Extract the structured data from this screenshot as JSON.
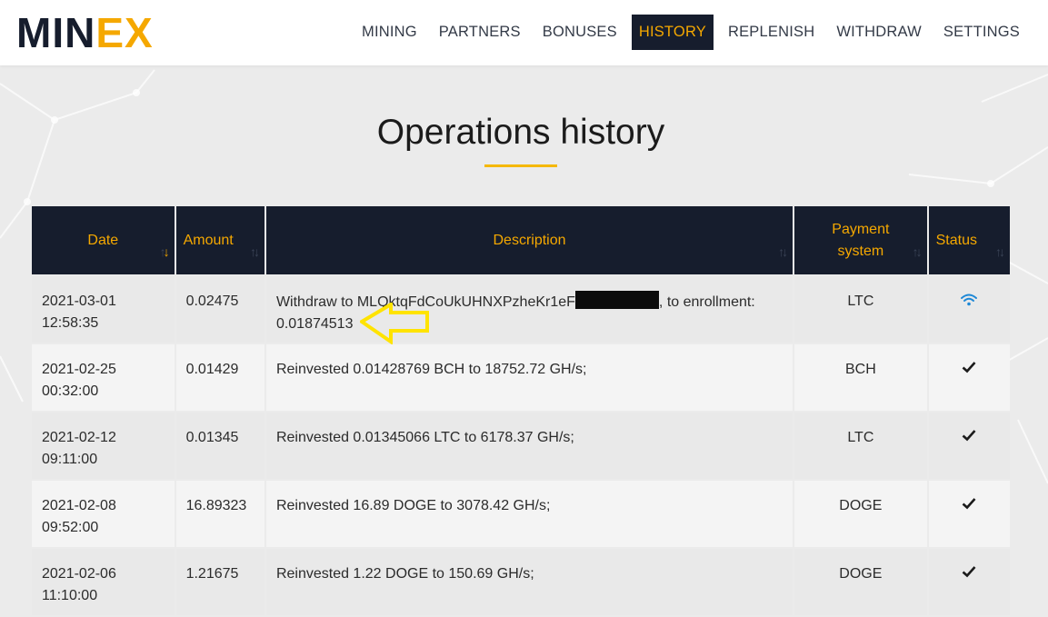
{
  "header": {
    "logo_prefix": "MIN",
    "logo_x": "EX",
    "nav": [
      {
        "label": "MINING",
        "active": false
      },
      {
        "label": "PARTNERS",
        "active": false
      },
      {
        "label": "BONUSES",
        "active": false
      },
      {
        "label": "HISTORY",
        "active": true
      },
      {
        "label": "REPLENISH",
        "active": false
      },
      {
        "label": "WITHDRAW",
        "active": false
      },
      {
        "label": "SETTINGS",
        "active": false
      }
    ]
  },
  "page": {
    "title": "Operations history"
  },
  "table": {
    "columns": [
      {
        "label": "Date",
        "sort_icon": "sort-active-icon"
      },
      {
        "label": "Amount",
        "sort_icon": "sort-icon"
      },
      {
        "label": "Description",
        "sort_icon": "sort-icon"
      },
      {
        "label": "Payment system",
        "sort_icon": "sort-icon"
      },
      {
        "label": "Status",
        "sort_icon": "sort-icon"
      }
    ],
    "rows": [
      {
        "date": "2021-03-01",
        "time": "12:58:35",
        "amount": "0.02475",
        "description_before": "Withdraw to MLQktqFdCoUkUHNXPzheKr1eF",
        "description_after": ", to enrollment: 0.01874513",
        "payment": "LTC",
        "status_icon": "pending-signal-icon"
      },
      {
        "date": "2021-02-25",
        "time": "00:32:00",
        "amount": "0.01429",
        "description": "Reinvested 0.01428769 BCH to 18752.72 GH/s;",
        "payment": "BCH",
        "status_icon": "checkmark-icon"
      },
      {
        "date": "2021-02-12",
        "time": "09:11:00",
        "amount": "0.01345",
        "description": "Reinvested 0.01345066 LTC to 6178.37 GH/s;",
        "payment": "LTC",
        "status_icon": "checkmark-icon"
      },
      {
        "date": "2021-02-08",
        "time": "09:52:00",
        "amount": "16.89323",
        "description": "Reinvested 16.89 DOGE to 3078.42 GH/s;",
        "payment": "DOGE",
        "status_icon": "checkmark-icon"
      },
      {
        "date": "2021-02-06",
        "time": "11:10:00",
        "amount": "1.21675",
        "description": "Reinvested 1.22 DOGE to 150.69 GH/s;",
        "payment": "DOGE",
        "status_icon": "checkmark-icon"
      }
    ]
  },
  "colors": {
    "navy": "#161d2d",
    "accent": "#f5a800",
    "arrow": "#ffe300",
    "pending_blue": "#1e88d6"
  }
}
